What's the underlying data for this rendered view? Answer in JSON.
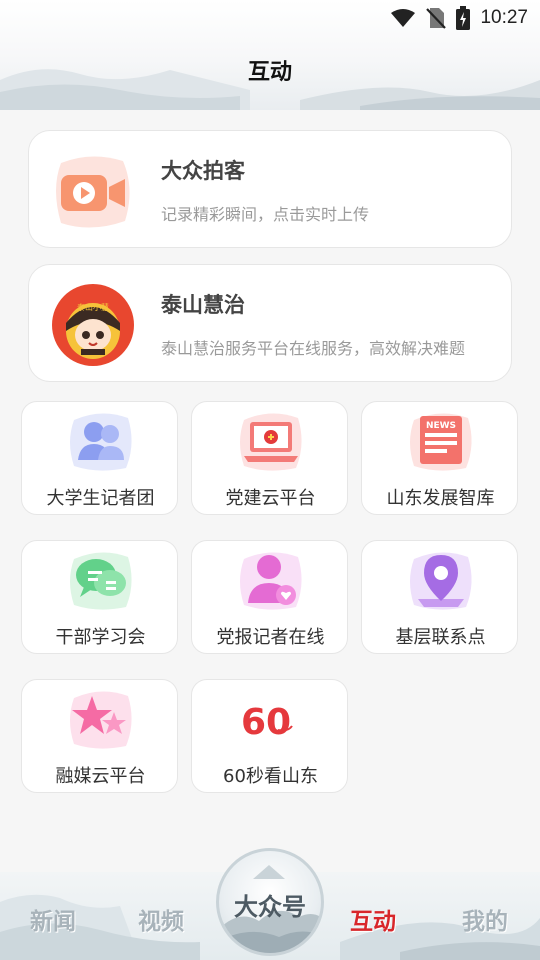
{
  "status_bar": {
    "time": "10:27"
  },
  "header": {
    "title": "互动"
  },
  "features": [
    {
      "name": "大众拍客",
      "desc": "记录精彩瞬间，点击实时上传"
    },
    {
      "name": "泰山慧治",
      "desc": "泰山慧治服务平台在线服务，高效解决难题",
      "avatar_text": "泰山小慧"
    }
  ],
  "tiles": [
    {
      "label": "大学生记者团"
    },
    {
      "label": "党建云平台"
    },
    {
      "label": "山东发展智库",
      "icon_text": "NEWS"
    },
    {
      "label": "干部学习会"
    },
    {
      "label": "党报记者在线"
    },
    {
      "label": "基层联系点"
    },
    {
      "label": "融媒云平台"
    },
    {
      "label": "60秒看山东",
      "icon_text": "60"
    }
  ],
  "bottom_nav": {
    "items": [
      {
        "label": "新闻"
      },
      {
        "label": "视频"
      },
      {
        "label": "互动"
      },
      {
        "label": "我的"
      }
    ],
    "center_label": "大众号",
    "active_color": "#d8262a"
  }
}
